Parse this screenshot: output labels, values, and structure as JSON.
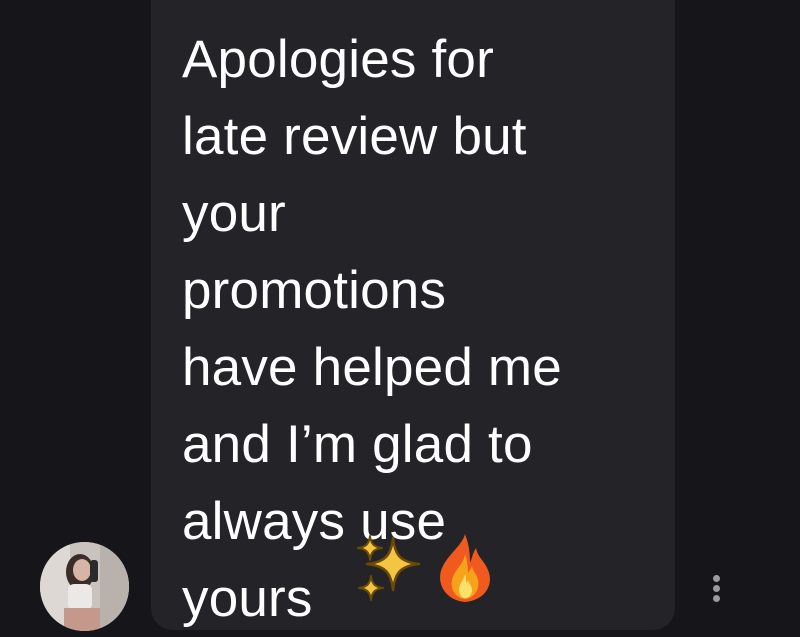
{
  "message": {
    "lines": [
      "Apologies for",
      "late review but",
      "your",
      "promotions",
      "have helped me",
      "and I’m glad to",
      "always use",
      "yours"
    ],
    "emojis": [
      "sparkles-icon",
      "fire-icon"
    ]
  },
  "colors": {
    "background": "#161519",
    "bubble": "#242428",
    "text": "#ffffff",
    "dots": "#9a9aa0"
  }
}
